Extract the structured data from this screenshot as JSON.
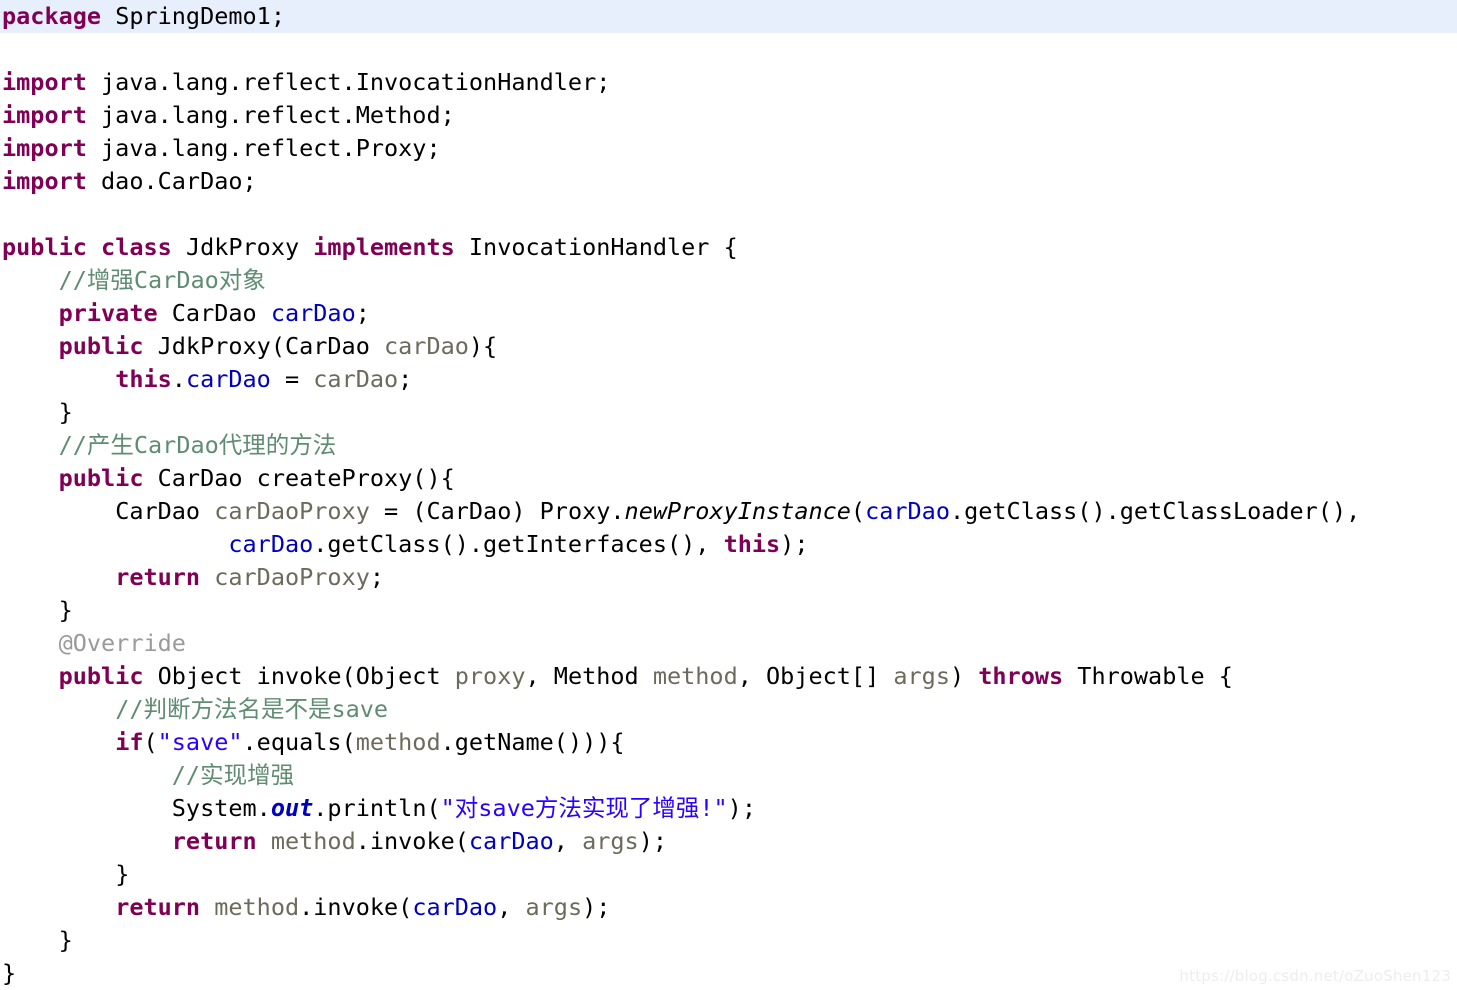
{
  "document": {
    "language": "Java",
    "package": "SpringDemo1",
    "class_name": "JdkProxy",
    "theme": {
      "background": "#ffffff",
      "highlight_line_background": "#e7effc",
      "keyword": "#7f0055",
      "plain": "#000000",
      "comment": "#5f8c72",
      "string": "#2a00ff",
      "field": "#0000c0",
      "parameter": "#6d6a5c",
      "annotation": "#9a9a9a",
      "watermark": "#ededed"
    }
  },
  "watermark": {
    "text": "https://blog.csdn.net/oZuoShen123"
  },
  "lines": [
    {
      "number": 1,
      "highlighted": true,
      "indent": 0,
      "tokens": [
        {
          "t": "package",
          "c": "kw"
        },
        {
          "t": " SpringDemo1;",
          "c": "plain"
        }
      ]
    },
    {
      "number": 2,
      "highlighted": false,
      "indent": 0,
      "tokens": []
    },
    {
      "number": 3,
      "highlighted": false,
      "indent": 0,
      "tokens": [
        {
          "t": "import",
          "c": "kw"
        },
        {
          "t": " java.lang.reflect.InvocationHandler;",
          "c": "plain"
        }
      ]
    },
    {
      "number": 4,
      "highlighted": false,
      "indent": 0,
      "tokens": [
        {
          "t": "import",
          "c": "kw"
        },
        {
          "t": " java.lang.reflect.Method;",
          "c": "plain"
        }
      ]
    },
    {
      "number": 5,
      "highlighted": false,
      "indent": 0,
      "tokens": [
        {
          "t": "import",
          "c": "kw"
        },
        {
          "t": " java.lang.reflect.Proxy;",
          "c": "plain"
        }
      ]
    },
    {
      "number": 6,
      "highlighted": false,
      "indent": 0,
      "tokens": [
        {
          "t": "import",
          "c": "kw"
        },
        {
          "t": " dao.CarDao;",
          "c": "plain"
        }
      ]
    },
    {
      "number": 7,
      "highlighted": false,
      "indent": 0,
      "tokens": []
    },
    {
      "number": 8,
      "highlighted": false,
      "indent": 0,
      "tokens": [
        {
          "t": "public",
          "c": "kw"
        },
        {
          "t": " ",
          "c": "plain"
        },
        {
          "t": "class",
          "c": "kw"
        },
        {
          "t": " JdkProxy ",
          "c": "plain"
        },
        {
          "t": "implements",
          "c": "kw"
        },
        {
          "t": " InvocationHandler {",
          "c": "plain"
        }
      ]
    },
    {
      "number": 9,
      "highlighted": false,
      "indent": 1,
      "tokens": [
        {
          "t": "//增强CarDao对象",
          "c": "cmt"
        }
      ]
    },
    {
      "number": 10,
      "highlighted": false,
      "indent": 1,
      "tokens": [
        {
          "t": "private",
          "c": "kw"
        },
        {
          "t": " CarDao ",
          "c": "plain"
        },
        {
          "t": "carDao",
          "c": "fld"
        },
        {
          "t": ";",
          "c": "plain"
        }
      ]
    },
    {
      "number": 11,
      "highlighted": false,
      "indent": 1,
      "tokens": [
        {
          "t": "public",
          "c": "kw"
        },
        {
          "t": " JdkProxy(CarDao ",
          "c": "plain"
        },
        {
          "t": "carDao",
          "c": "par"
        },
        {
          "t": "){",
          "c": "plain"
        }
      ]
    },
    {
      "number": 12,
      "highlighted": false,
      "indent": 2,
      "tokens": [
        {
          "t": "this",
          "c": "kw"
        },
        {
          "t": ".",
          "c": "plain"
        },
        {
          "t": "carDao",
          "c": "fld"
        },
        {
          "t": " = ",
          "c": "plain"
        },
        {
          "t": "carDao",
          "c": "par"
        },
        {
          "t": ";",
          "c": "plain"
        }
      ]
    },
    {
      "number": 13,
      "highlighted": false,
      "indent": 1,
      "tokens": [
        {
          "t": "}",
          "c": "plain"
        }
      ]
    },
    {
      "number": 14,
      "highlighted": false,
      "indent": 1,
      "tokens": [
        {
          "t": "//产生CarDao代理的方法",
          "c": "cmt"
        }
      ]
    },
    {
      "number": 15,
      "highlighted": false,
      "indent": 1,
      "tokens": [
        {
          "t": "public",
          "c": "kw"
        },
        {
          "t": " CarDao createProxy(){",
          "c": "plain"
        }
      ]
    },
    {
      "number": 16,
      "highlighted": false,
      "indent": 2,
      "tokens": [
        {
          "t": "CarDao ",
          "c": "plain"
        },
        {
          "t": "carDaoProxy",
          "c": "par"
        },
        {
          "t": " = (CarDao) Proxy.",
          "c": "plain"
        },
        {
          "t": "newProxyInstance",
          "c": "stm"
        },
        {
          "t": "(",
          "c": "plain"
        },
        {
          "t": "carDao",
          "c": "fld"
        },
        {
          "t": ".getClass().getClassLoader(),",
          "c": "plain"
        }
      ]
    },
    {
      "number": 17,
      "highlighted": false,
      "indent": 4,
      "tokens": [
        {
          "t": "carDao",
          "c": "fld"
        },
        {
          "t": ".getClass().getInterfaces(), ",
          "c": "plain"
        },
        {
          "t": "this",
          "c": "kw"
        },
        {
          "t": ");",
          "c": "plain"
        }
      ]
    },
    {
      "number": 18,
      "highlighted": false,
      "indent": 2,
      "tokens": [
        {
          "t": "return",
          "c": "kw"
        },
        {
          "t": " ",
          "c": "plain"
        },
        {
          "t": "carDaoProxy",
          "c": "par"
        },
        {
          "t": ";",
          "c": "plain"
        }
      ]
    },
    {
      "number": 19,
      "highlighted": false,
      "indent": 1,
      "tokens": [
        {
          "t": "}",
          "c": "plain"
        }
      ]
    },
    {
      "number": 20,
      "highlighted": false,
      "indent": 1,
      "tokens": [
        {
          "t": "@Override",
          "c": "ann"
        }
      ]
    },
    {
      "number": 21,
      "highlighted": false,
      "indent": 1,
      "tokens": [
        {
          "t": "public",
          "c": "kw"
        },
        {
          "t": " Object invoke(Object ",
          "c": "plain"
        },
        {
          "t": "proxy",
          "c": "par"
        },
        {
          "t": ", Method ",
          "c": "plain"
        },
        {
          "t": "method",
          "c": "par"
        },
        {
          "t": ", Object[] ",
          "c": "plain"
        },
        {
          "t": "args",
          "c": "par"
        },
        {
          "t": ") ",
          "c": "plain"
        },
        {
          "t": "throws",
          "c": "kw"
        },
        {
          "t": " Throwable {",
          "c": "plain"
        }
      ]
    },
    {
      "number": 22,
      "highlighted": false,
      "indent": 2,
      "tokens": [
        {
          "t": "//判断方法名是不是save",
          "c": "cmt"
        }
      ]
    },
    {
      "number": 23,
      "highlighted": false,
      "indent": 2,
      "tokens": [
        {
          "t": "if",
          "c": "kw"
        },
        {
          "t": "(",
          "c": "plain"
        },
        {
          "t": "\"save\"",
          "c": "str"
        },
        {
          "t": ".equals(",
          "c": "plain"
        },
        {
          "t": "method",
          "c": "par"
        },
        {
          "t": ".getName())){",
          "c": "plain"
        }
      ]
    },
    {
      "number": 24,
      "highlighted": false,
      "indent": 3,
      "tokens": [
        {
          "t": "//实现增强",
          "c": "cmt"
        }
      ]
    },
    {
      "number": 25,
      "highlighted": false,
      "indent": 3,
      "tokens": [
        {
          "t": "System.",
          "c": "plain"
        },
        {
          "t": "out",
          "c": "stf"
        },
        {
          "t": ".println(",
          "c": "plain"
        },
        {
          "t": "\"对save方法实现了增强!\"",
          "c": "str"
        },
        {
          "t": ");",
          "c": "plain"
        }
      ]
    },
    {
      "number": 26,
      "highlighted": false,
      "indent": 3,
      "tokens": [
        {
          "t": "return",
          "c": "kw"
        },
        {
          "t": " ",
          "c": "plain"
        },
        {
          "t": "method",
          "c": "par"
        },
        {
          "t": ".invoke(",
          "c": "plain"
        },
        {
          "t": "carDao",
          "c": "fld"
        },
        {
          "t": ", ",
          "c": "plain"
        },
        {
          "t": "args",
          "c": "par"
        },
        {
          "t": ");",
          "c": "plain"
        }
      ]
    },
    {
      "number": 27,
      "highlighted": false,
      "indent": 2,
      "tokens": [
        {
          "t": "}",
          "c": "plain"
        }
      ]
    },
    {
      "number": 28,
      "highlighted": false,
      "indent": 2,
      "tokens": [
        {
          "t": "return",
          "c": "kw"
        },
        {
          "t": " ",
          "c": "plain"
        },
        {
          "t": "method",
          "c": "par"
        },
        {
          "t": ".invoke(",
          "c": "plain"
        },
        {
          "t": "carDao",
          "c": "fld"
        },
        {
          "t": ", ",
          "c": "plain"
        },
        {
          "t": "args",
          "c": "par"
        },
        {
          "t": ");",
          "c": "plain"
        }
      ]
    },
    {
      "number": 29,
      "highlighted": false,
      "indent": 1,
      "tokens": [
        {
          "t": "}",
          "c": "plain"
        }
      ]
    },
    {
      "number": 30,
      "highlighted": false,
      "indent": 0,
      "tokens": [
        {
          "t": "}",
          "c": "plain"
        }
      ]
    }
  ]
}
